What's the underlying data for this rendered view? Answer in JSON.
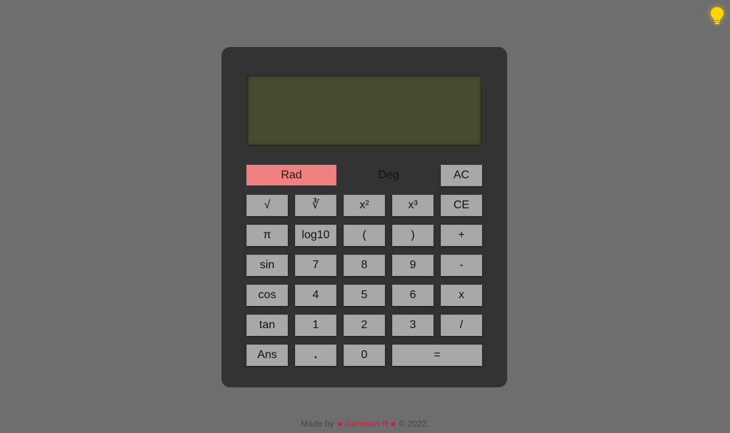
{
  "theme_toggle": {
    "icon": "lightbulb-icon",
    "color": "#ffd700"
  },
  "display": {
    "value": "",
    "background": "#474b2f"
  },
  "modes": {
    "rad": "Rad",
    "deg": "Deg",
    "active": "Rad",
    "active_color": "#f08080"
  },
  "keys": {
    "ac": "AC",
    "sqrt": "√",
    "cbrt": "∛",
    "square": "x²",
    "cube": "x³",
    "ce": "CE",
    "pi": "π",
    "log10": "log10",
    "lparen": "(",
    "rparen": ")",
    "plus": "+",
    "sin": "sin",
    "seven": "7",
    "eight": "8",
    "nine": "9",
    "minus": "-",
    "cos": "cos",
    "four": "4",
    "five": "5",
    "six": "6",
    "multiply": "x",
    "tan": "tan",
    "one": "1",
    "two": "2",
    "three": "3",
    "divide": "/",
    "ans": "Ans",
    "dot": ".",
    "zero": "0",
    "equals": "="
  },
  "footer": {
    "prefix": "Made by",
    "author": "►Ganesan R◄",
    "suffix": "© 2022."
  }
}
